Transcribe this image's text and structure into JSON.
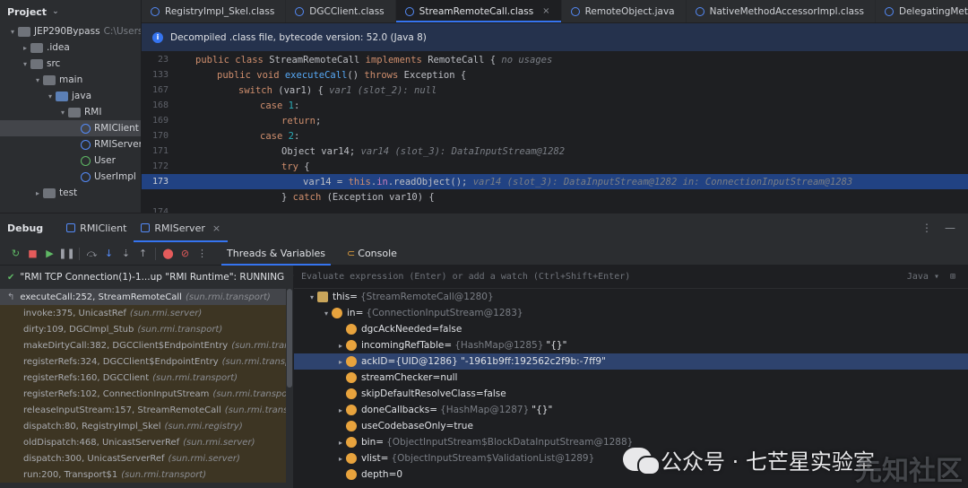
{
  "project": {
    "title": "Project",
    "tree": [
      {
        "indent": 0,
        "arrow": "▾",
        "icon": "folder",
        "label": "JEP290Bypass",
        "meta": "C:\\Users\\"
      },
      {
        "indent": 1,
        "arrow": "▸",
        "icon": "folder",
        "label": ".idea"
      },
      {
        "indent": 1,
        "arrow": "▾",
        "icon": "folder",
        "label": "src"
      },
      {
        "indent": 2,
        "arrow": "▾",
        "icon": "folder",
        "label": "main"
      },
      {
        "indent": 3,
        "arrow": "▾",
        "icon": "folder-src",
        "label": "java"
      },
      {
        "indent": 4,
        "arrow": "▾",
        "icon": "folder",
        "label": "RMI"
      },
      {
        "indent": 5,
        "arrow": "",
        "icon": "class",
        "label": "RMIClient",
        "selected": true
      },
      {
        "indent": 5,
        "arrow": "",
        "icon": "class",
        "label": "RMIServer"
      },
      {
        "indent": 5,
        "arrow": "",
        "icon": "interface",
        "label": "User"
      },
      {
        "indent": 5,
        "arrow": "",
        "icon": "class",
        "label": "UserImpl"
      },
      {
        "indent": 2,
        "arrow": "▸",
        "icon": "folder",
        "label": "test"
      }
    ]
  },
  "editor": {
    "tabs": [
      {
        "label": "RegistryImpl_Skel.class"
      },
      {
        "label": "DGCClient.class"
      },
      {
        "label": "StreamRemoteCall.class",
        "active": true
      },
      {
        "label": "RemoteObject.java"
      },
      {
        "label": "NativeMethodAccessorImpl.class"
      },
      {
        "label": "DelegatingMethodAccesso"
      }
    ],
    "close_glyph": "×",
    "banner": "Decompiled .class file, bytecode version: 52.0 (Java 8)",
    "lines": [
      {
        "n": "23",
        "seg": [
          [
            "kw",
            "public class "
          ],
          [
            "pl",
            "StreamRemoteCall "
          ],
          [
            "kw",
            "implements "
          ],
          [
            "pl",
            "RemoteCall {  "
          ],
          [
            "cm",
            "no usages"
          ]
        ],
        "ind": 0
      },
      {
        "n": "133",
        "seg": [
          [
            "kw",
            "public void "
          ],
          [
            "fn",
            "executeCall"
          ],
          [
            "pl",
            "() "
          ],
          [
            "kw",
            "throws "
          ],
          [
            "pl",
            "Exception {"
          ]
        ],
        "ind": 1
      },
      {
        "n": "167",
        "seg": [
          [
            "kw",
            "switch "
          ],
          [
            "pl",
            "(var1) {  "
          ],
          [
            "cm",
            "var1 (slot_2): null"
          ]
        ],
        "ind": 2
      },
      {
        "n": "168",
        "seg": [
          [
            "kw",
            "case "
          ],
          [
            "num",
            "1"
          ],
          [
            "pl",
            ":"
          ]
        ],
        "ind": 3
      },
      {
        "n": "169",
        "seg": [
          [
            "kw",
            "return"
          ],
          [
            "pl",
            ";"
          ]
        ],
        "ind": 4
      },
      {
        "n": "170",
        "seg": [
          [
            "kw",
            "case "
          ],
          [
            "num",
            "2"
          ],
          [
            "pl",
            ":"
          ]
        ],
        "ind": 3
      },
      {
        "n": "171",
        "seg": [
          [
            "pl",
            "Object var14;  "
          ],
          [
            "cm",
            "var14 (slot_3): DataInputStream@1282"
          ]
        ],
        "ind": 4
      },
      {
        "n": "172",
        "seg": [
          [
            "kw",
            "try "
          ],
          [
            "pl",
            "{"
          ]
        ],
        "ind": 4
      },
      {
        "n": "173",
        "seg": [
          [
            "pl",
            "var14 = "
          ],
          [
            "kw",
            "this"
          ],
          [
            "pl",
            "."
          ],
          [
            "fld",
            "in"
          ],
          [
            "pl",
            ".readObject();   "
          ],
          [
            "cm",
            "var14 (slot_3): DataInputStream@1282    in: ConnectionInputStream@1283"
          ]
        ],
        "ind": 5,
        "hl": true
      },
      {
        "n": "",
        "seg": [
          [
            "pl",
            "} "
          ],
          [
            "kw",
            "catch "
          ],
          [
            "pl",
            "(Exception var10) {"
          ]
        ],
        "ind": 4
      },
      {
        "n": "174",
        "seg": [],
        "ind": 5
      }
    ]
  },
  "debug": {
    "title": "Debug",
    "tabs": [
      {
        "label": "RMIClient"
      },
      {
        "label": "RMIServer",
        "active": true
      }
    ],
    "right_icons": [
      "⋮",
      "—"
    ],
    "subtabs": [
      {
        "label": "Threads & Variables",
        "active": true
      },
      {
        "label": "Console"
      }
    ],
    "thread": "\"RMI TCP Connection(1)-1...up \"RMI Runtime\": RUNNING",
    "frames": [
      {
        "m": "executeCall:252, StreamRemoteCall",
        "p": "(sun.rmi.transport)",
        "cur": true
      },
      {
        "m": "invoke:375, UnicastRef",
        "p": "(sun.rmi.server)"
      },
      {
        "m": "dirty:109, DGCImpl_Stub",
        "p": "(sun.rmi.transport)"
      },
      {
        "m": "makeDirtyCall:382, DGCClient$EndpointEntry",
        "p": "(sun.rmi.transport)"
      },
      {
        "m": "registerRefs:324, DGCClient$EndpointEntry",
        "p": "(sun.rmi.transport)"
      },
      {
        "m": "registerRefs:160, DGCClient",
        "p": "(sun.rmi.transport)"
      },
      {
        "m": "registerRefs:102, ConnectionInputStream",
        "p": "(sun.rmi.transport)"
      },
      {
        "m": "releaseInputStream:157, StreamRemoteCall",
        "p": "(sun.rmi.transport)"
      },
      {
        "m": "dispatch:80, RegistryImpl_Skel",
        "p": "(sun.rmi.registry)"
      },
      {
        "m": "oldDispatch:468, UnicastServerRef",
        "p": "(sun.rmi.server)"
      },
      {
        "m": "dispatch:300, UnicastServerRef",
        "p": "(sun.rmi.server)"
      },
      {
        "m": "run:200, Transport$1",
        "p": "(sun.rmi.transport)"
      }
    ],
    "eval_placeholder": "Evaluate expression (Enter) or add a watch (Ctrl+Shift+Enter)",
    "eval_lang": "Java ▾",
    "vars": [
      {
        "d": 0,
        "exp": "▾",
        "icon": "list",
        "name": "this",
        "eq": " = ",
        "gray": "{StreamRemoteCall@1280}",
        "val": ""
      },
      {
        "d": 1,
        "exp": "▾",
        "icon": "field",
        "name": "in",
        "eq": " = ",
        "gray": "{ConnectionInputStream@1283}",
        "val": ""
      },
      {
        "d": 2,
        "exp": "",
        "icon": "field",
        "name": "dgcAckNeeded",
        "eq": " = ",
        "gray": "",
        "val": "false"
      },
      {
        "d": 2,
        "exp": "▸",
        "icon": "field",
        "name": "incomingRefTable",
        "eq": " = ",
        "gray": "{HashMap@1285}",
        "val": "\"{}\""
      },
      {
        "d": 2,
        "exp": "▸",
        "icon": "field",
        "name": "ackID",
        "eq": " = ",
        "gray": "",
        "val": "{UID@1286} \"-1961b9ff:192562c2f9b:-7ff9\"",
        "sel": true
      },
      {
        "d": 2,
        "exp": "",
        "icon": "field",
        "name": "streamChecker",
        "eq": " = ",
        "gray": "",
        "val": "null"
      },
      {
        "d": 2,
        "exp": "",
        "icon": "field",
        "name": "skipDefaultResolveClass",
        "eq": " = ",
        "gray": "",
        "val": "false"
      },
      {
        "d": 2,
        "exp": "▸",
        "icon": "field",
        "name": "doneCallbacks",
        "eq": " = ",
        "gray": "{HashMap@1287}",
        "val": "\"{}\""
      },
      {
        "d": 2,
        "exp": "",
        "icon": "field",
        "name": "useCodebaseOnly",
        "eq": " = ",
        "gray": "",
        "val": "true"
      },
      {
        "d": 2,
        "exp": "▸",
        "icon": "field",
        "name": "bin",
        "eq": " = ",
        "gray": "{ObjectInputStream$BlockDataInputStream@1288}",
        "val": ""
      },
      {
        "d": 2,
        "exp": "▸",
        "icon": "field",
        "name": "vlist",
        "eq": " = ",
        "gray": "{ObjectInputStream$ValidationList@1289}",
        "val": ""
      },
      {
        "d": 2,
        "exp": "",
        "icon": "field",
        "name": "depth",
        "eq": " = ",
        "gray": "",
        "val": "0"
      }
    ]
  },
  "watermark": {
    "text": "公众号 · 七芒星实验室",
    "secondary": "先知社区"
  }
}
